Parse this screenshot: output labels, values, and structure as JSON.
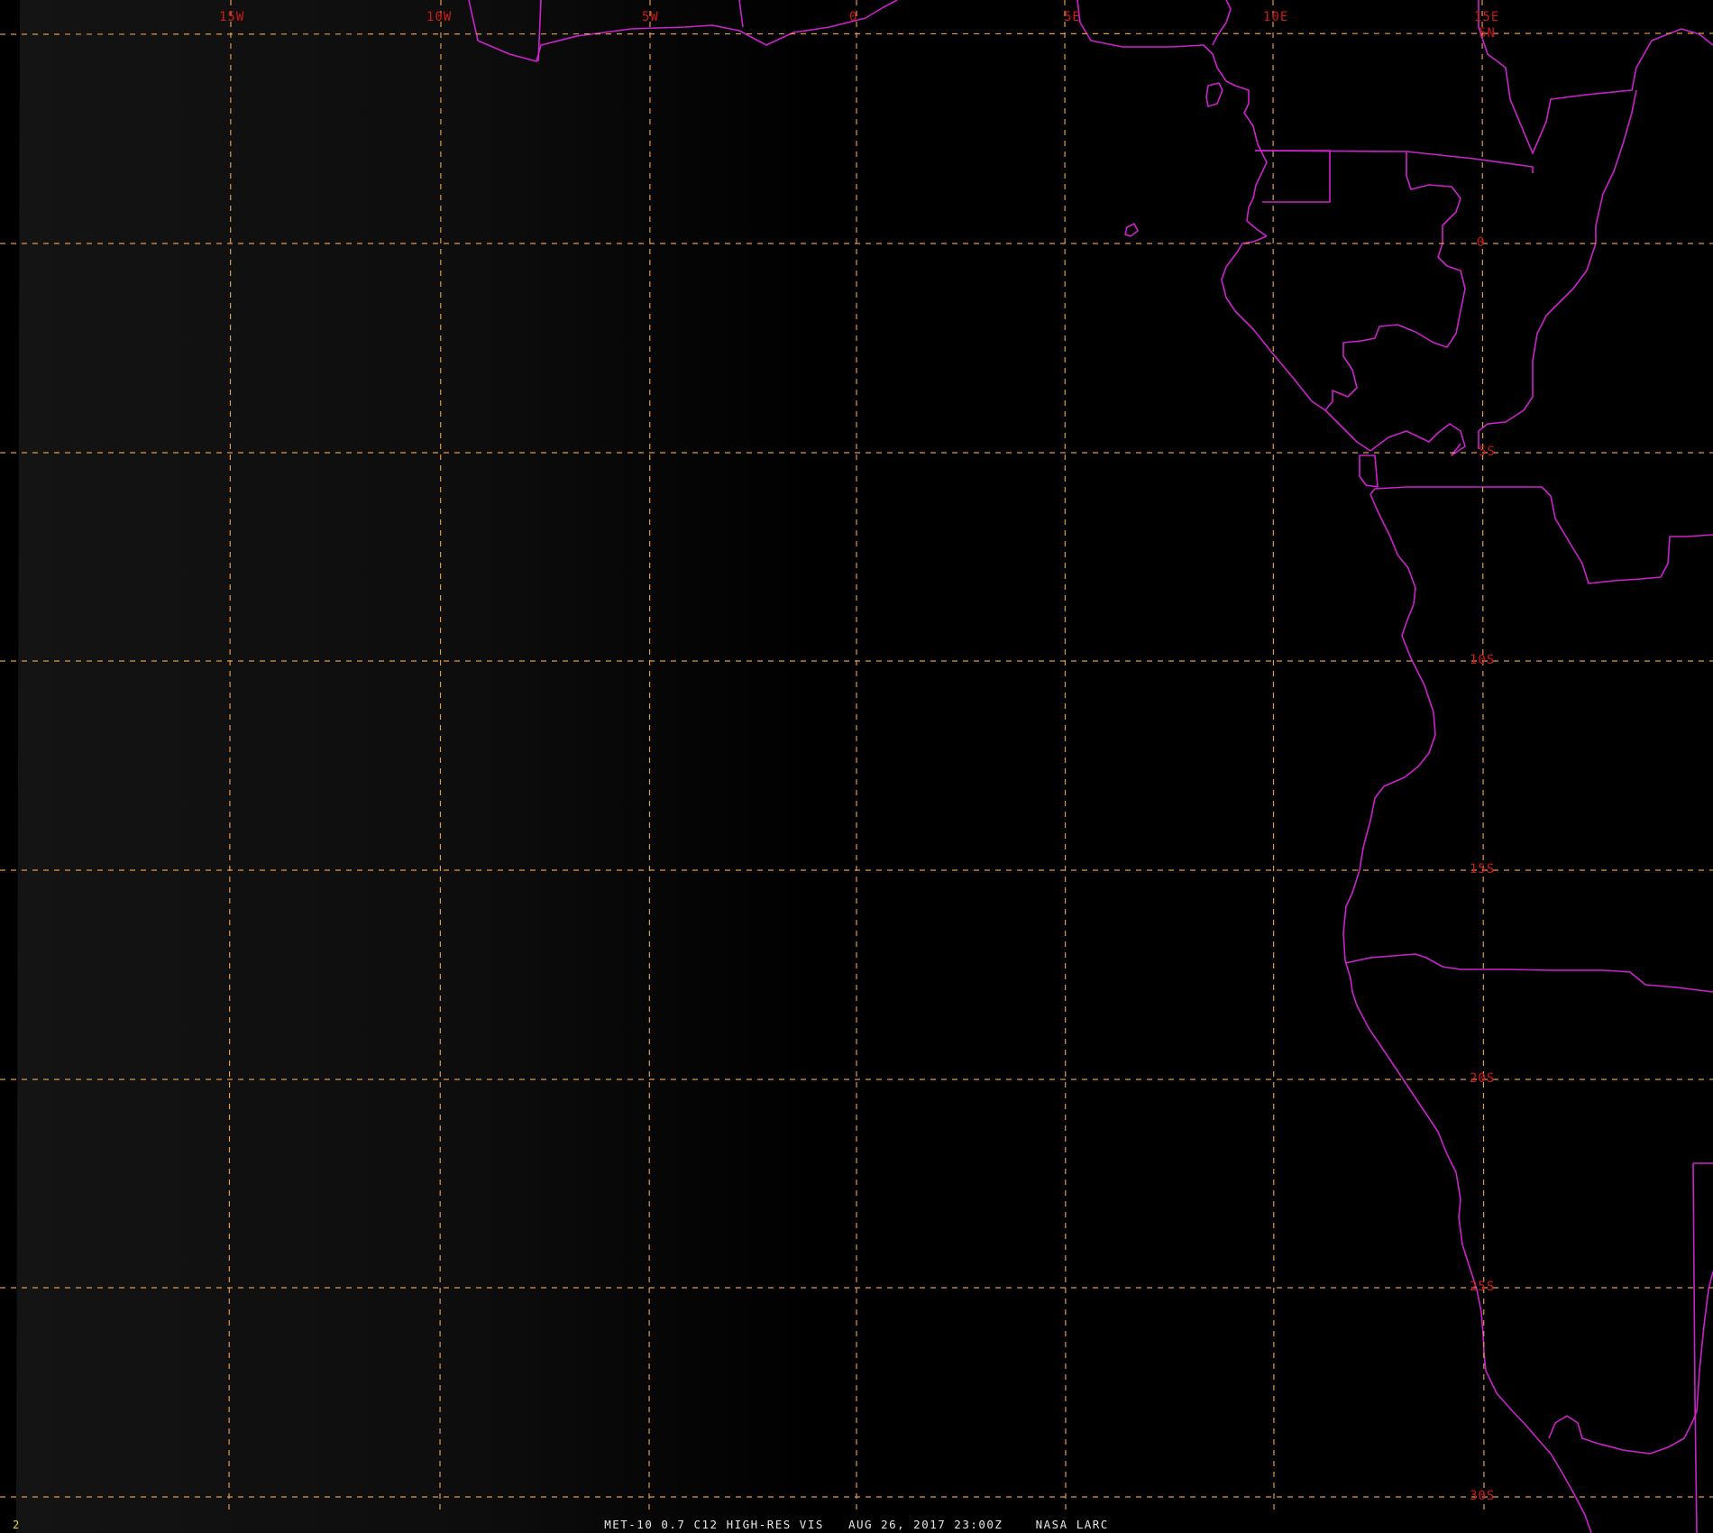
{
  "frame_number": "2",
  "caption": {
    "product": "MET-10 0.7 C12 HIGH-RES VIS",
    "datetime": "AUG 26, 2017 23:00Z",
    "source": "NASA LARC"
  },
  "grid": {
    "longitude_labels": [
      "15W",
      "10W",
      "5W",
      "0",
      "5E",
      "10E",
      "15E"
    ],
    "latitude_labels": [
      "5N",
      "0",
      "5S",
      "10S",
      "15S",
      "20S",
      "25S",
      "30S"
    ],
    "line_style": "dashed",
    "line_color": "#e09a4a",
    "label_color": "#d01818"
  },
  "map": {
    "coastline_color": "#cc22cc",
    "background": "night (dark), faint twilight glow on western edge"
  }
}
